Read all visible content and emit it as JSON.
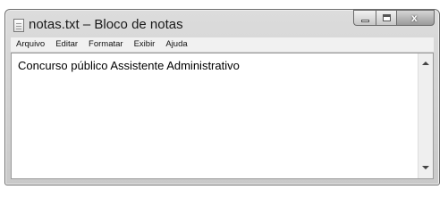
{
  "window": {
    "title": "notas.txt – Bloco de notas",
    "icon": "notepad-icon"
  },
  "controls": {
    "minimize": "minimize-icon",
    "maximize": "maximize-icon",
    "close": "close-icon",
    "close_glyph": "x"
  },
  "menu": {
    "items": [
      "Arquivo",
      "Editar",
      "Formatar",
      "Exibir",
      "Ajuda"
    ]
  },
  "editor": {
    "content": "Concurso público Assistente Administrativo"
  }
}
